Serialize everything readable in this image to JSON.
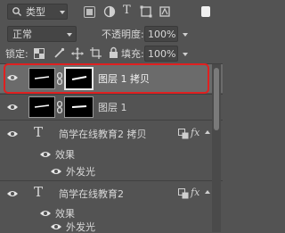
{
  "filter": {
    "label": "类型"
  },
  "blend": {
    "mode": "正常",
    "opacity_label": "不透明度:",
    "opacity_value": "100%"
  },
  "lock": {
    "label": "锁定:",
    "fill_label": "填充:",
    "fill_value": "100%"
  },
  "layers": [
    {
      "name": "图层 1 拷贝",
      "kind": "image",
      "selected": true
    },
    {
      "name": "图层 1",
      "kind": "image"
    },
    {
      "name": "简学在线教育2 拷贝",
      "kind": "text",
      "effects_label": "效果",
      "effect": "外发光"
    },
    {
      "name": "简学在线教育2",
      "kind": "text",
      "effects_label": "效果",
      "effect": "外发光"
    }
  ],
  "colors": {
    "panel": "#535353",
    "selected_row": "#6b6b6b",
    "highlight": "#e02020"
  }
}
